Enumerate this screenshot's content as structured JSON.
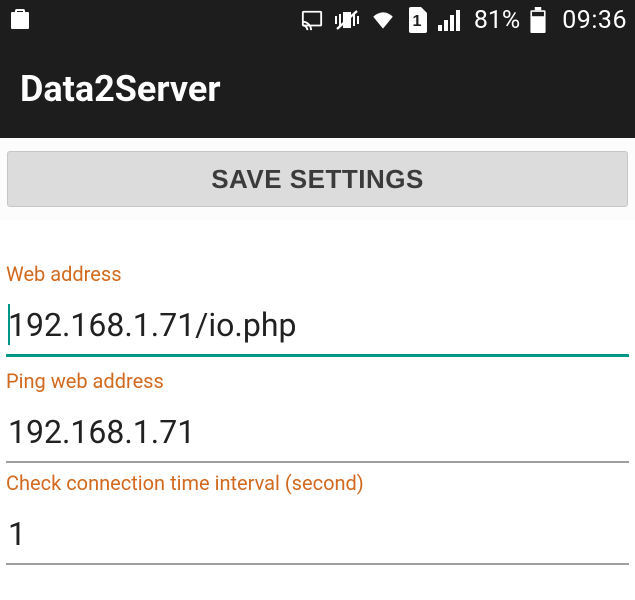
{
  "status_bar": {
    "battery_pct": "81%",
    "clock": "09:36"
  },
  "app_bar": {
    "title": "Data2Server"
  },
  "buttons": {
    "save_label": "SAVE SETTINGS"
  },
  "fields": {
    "web_address": {
      "label": "Web address",
      "value": "192.168.1.71/io.php"
    },
    "ping_web_address": {
      "label": "Ping web address",
      "value": "192.168.1.71"
    },
    "check_interval": {
      "label": "Check connection time interval (second)",
      "value": "1"
    }
  },
  "colors": {
    "accent": "#009688",
    "label": "#d2691e",
    "bar": "#1d1d1d"
  }
}
